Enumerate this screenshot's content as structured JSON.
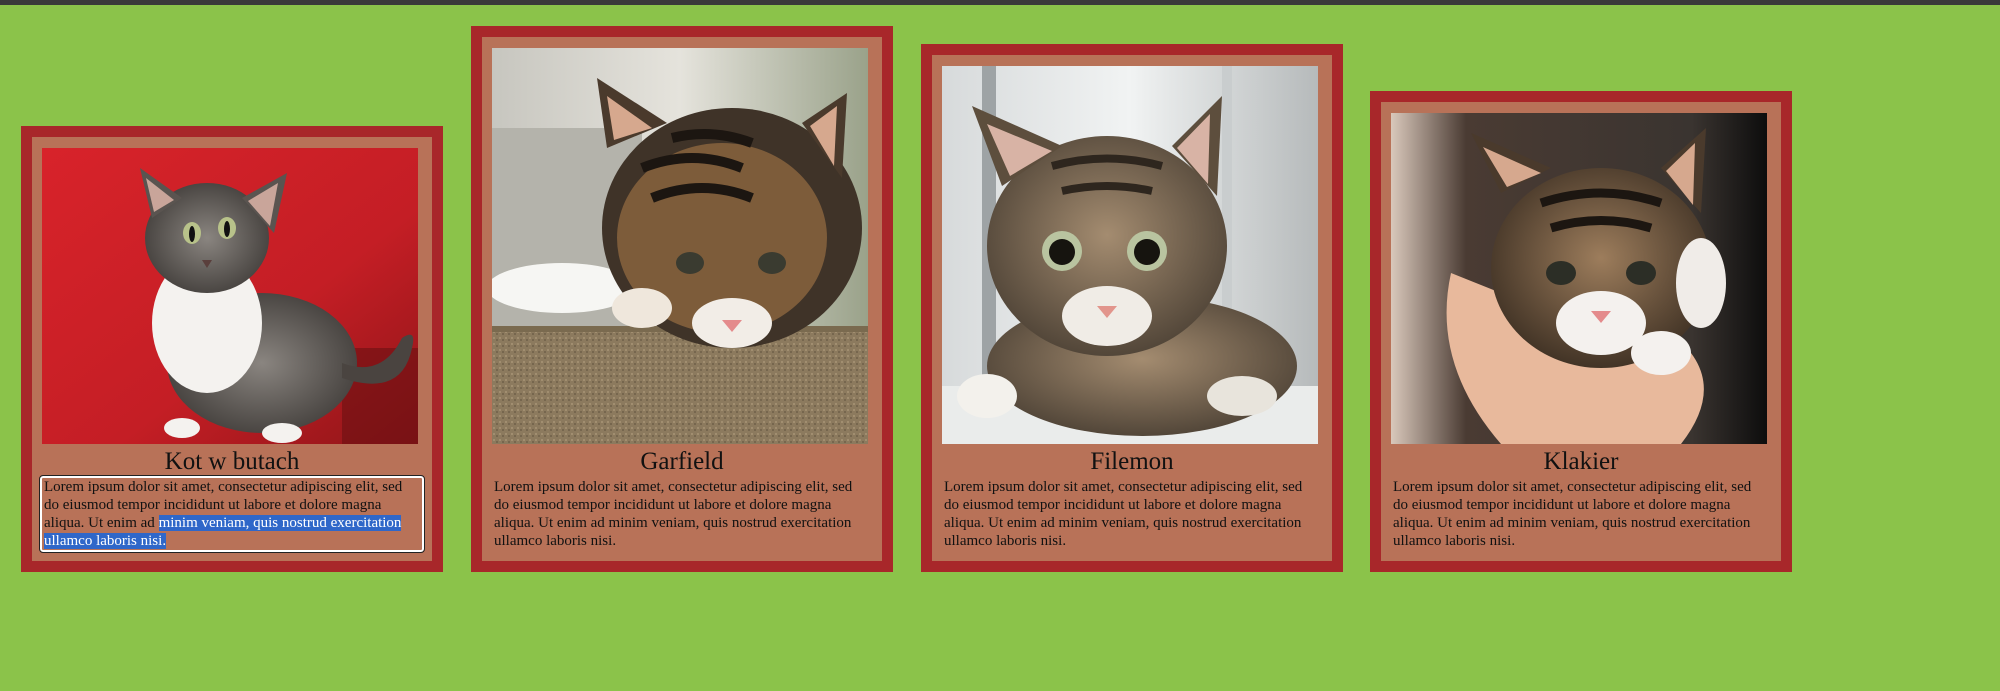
{
  "colors": {
    "background": "#8bc34a",
    "card_fill": "#b87258",
    "card_border": "#a8272a",
    "selection": "#2f67c9"
  },
  "cards": [
    {
      "name": "Kot w butach",
      "photo_icon": "kitten-photo",
      "text_plain": "Lorem ipsum dolor sit amet, consectetur adipiscing elit, sed do eiusmod tempor incididunt ut labore et dolore magna aliqua. Ut enim ad ",
      "text_selected": "minim veniam, quis nostrud exercitation ullamco laboris nisi."
    },
    {
      "name": "Garfield",
      "photo_icon": "kitten-photo",
      "text": "Lorem ipsum dolor sit amet, consectetur adipiscing elit, sed do eiusmod tempor incididunt ut labore et dolore magna aliqua. Ut enim ad minim veniam, quis nostrud exercitation ullamco laboris nisi."
    },
    {
      "name": "Filemon",
      "photo_icon": "kitten-photo",
      "text": "Lorem ipsum dolor sit amet, consectetur adipiscing elit, sed do eiusmod tempor incididunt ut labore et dolore magna aliqua. Ut enim ad minim veniam, quis nostrud exercitation ullamco laboris nisi."
    },
    {
      "name": "Klakier",
      "photo_icon": "kitten-photo",
      "text": "Lorem ipsum dolor sit amet, consectetur adipiscing elit, sed do eiusmod tempor incididunt ut labore et dolore magna aliqua. Ut enim ad minim veniam, quis nostrud exercitation ullamco laboris nisi."
    }
  ]
}
